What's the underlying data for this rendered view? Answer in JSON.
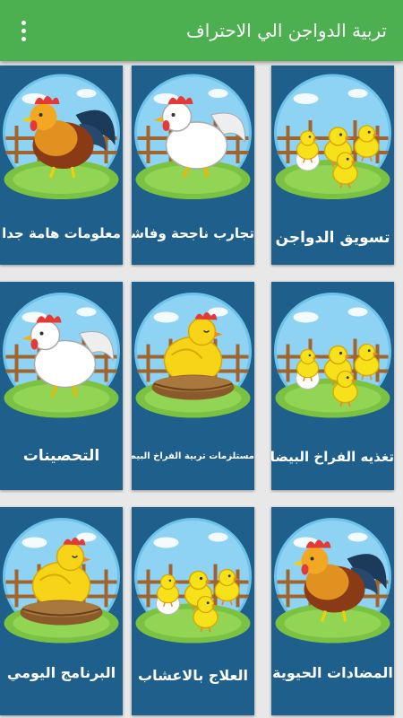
{
  "app": {
    "title": "تربية الدواجن الي الاحتراف"
  },
  "cards": [
    {
      "label": "تسويق الدواجن",
      "illustration": "chicks-icon"
    },
    {
      "label": "تجارب ناجحة وفاشلة",
      "illustration": "white-rooster-icon"
    },
    {
      "label": "معلومات هامة جدا",
      "illustration": "rooster-icon"
    },
    {
      "label": "تغذيه الفراخ  البيضاء",
      "illustration": "chicks-icon"
    },
    {
      "label": "مستلزمات تربية الفراخ البيضاء",
      "illustration": "hen-nest-icon"
    },
    {
      "label": "التحصينات",
      "illustration": "white-rooster-icon"
    },
    {
      "label": "المضادات الحيوية",
      "illustration": "rooster-icon"
    },
    {
      "label": "العلاج بالاعشاب",
      "illustration": "chicks-icon"
    },
    {
      "label": "البرنامج اليومي",
      "illustration": "hen-nest-icon"
    }
  ],
  "colors": {
    "appbar": "#4caf50",
    "card": "#1f5f8b",
    "circle": "#8fd3f4",
    "grass": "#7cc242",
    "fence": "#a0642e"
  }
}
